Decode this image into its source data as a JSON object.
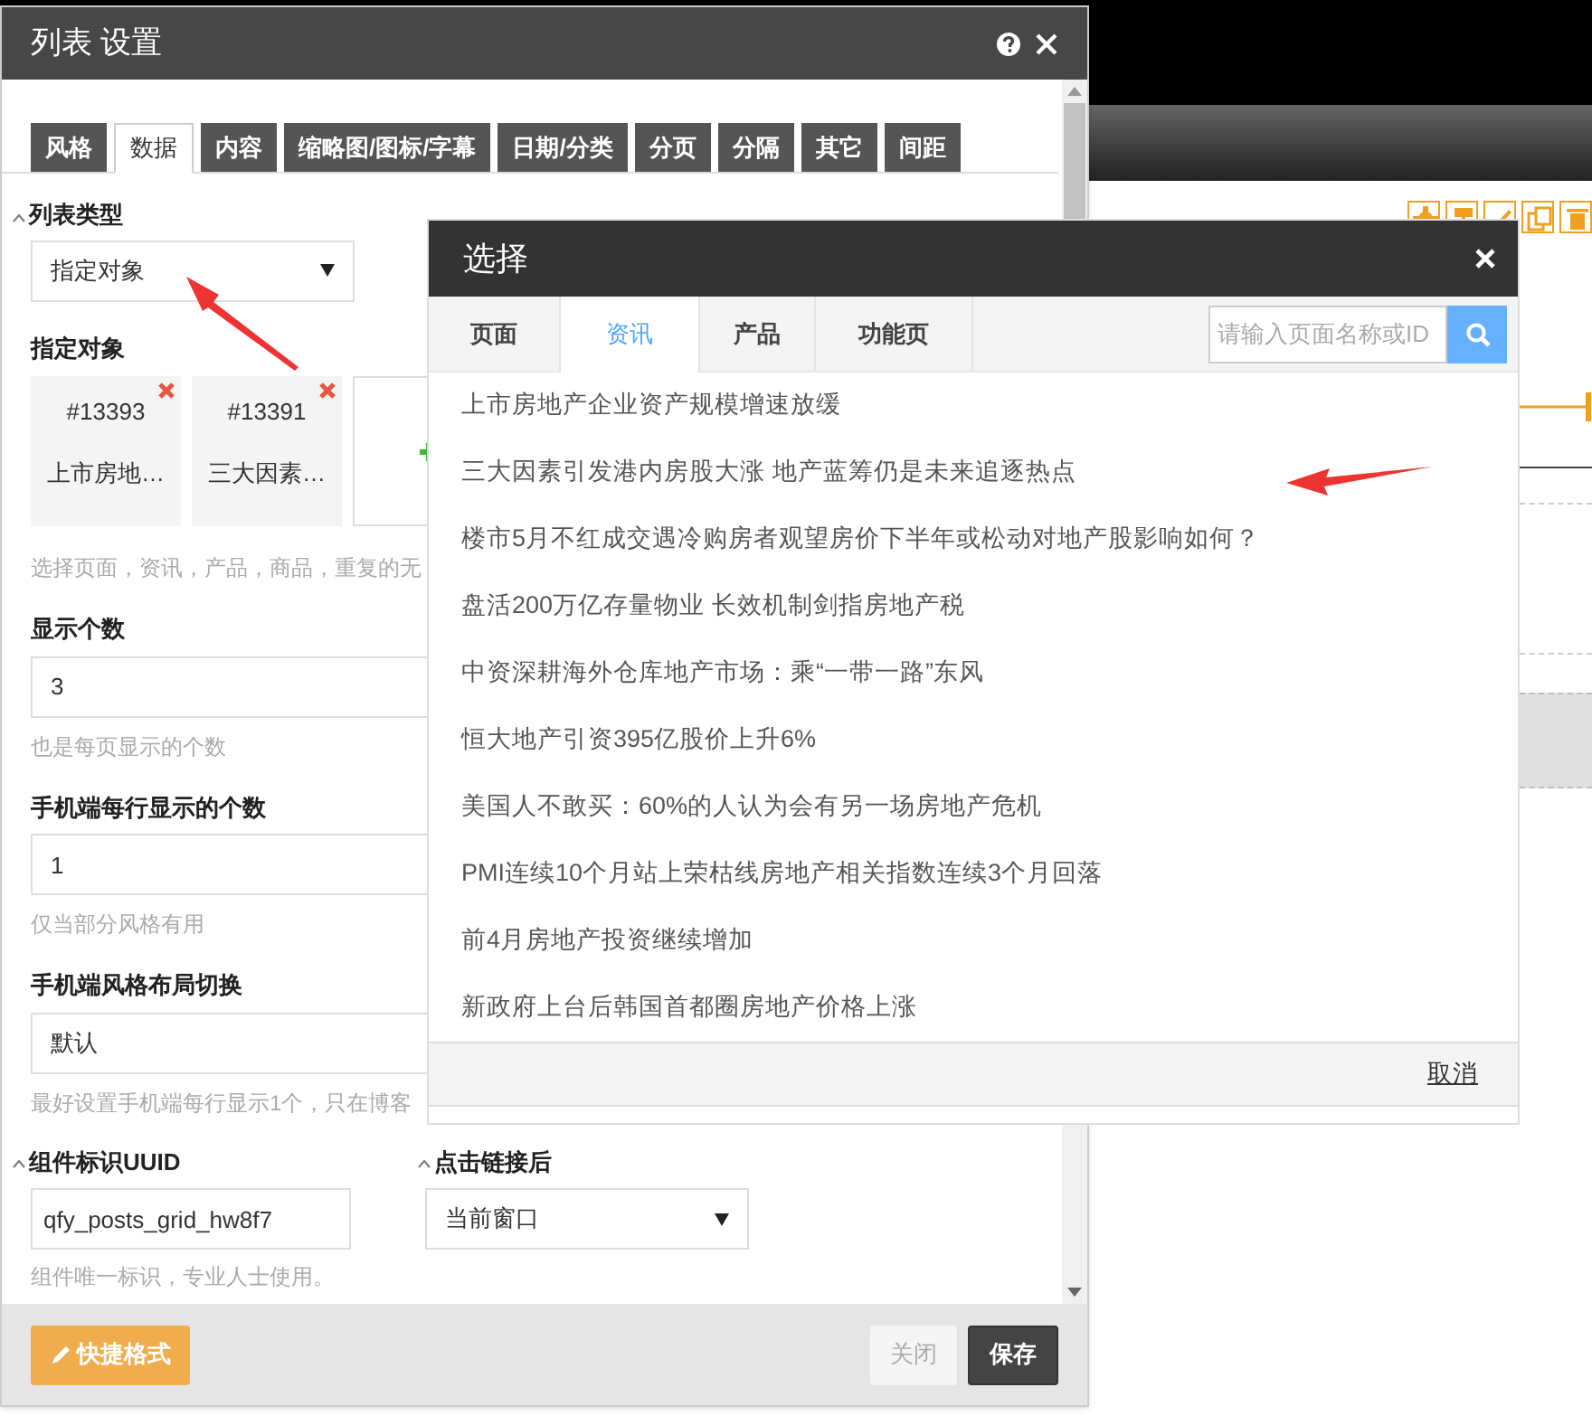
{
  "settings_dialog": {
    "title": "列表 设置",
    "tabs": [
      {
        "label": "风格",
        "selected": false
      },
      {
        "label": "数据",
        "selected": true
      },
      {
        "label": "内容",
        "selected": false
      },
      {
        "label": "缩略图/图标/字幕",
        "selected": false
      },
      {
        "label": "日期/分类",
        "selected": false
      },
      {
        "label": "分页",
        "selected": false
      },
      {
        "label": "分隔",
        "selected": false
      },
      {
        "label": "其它",
        "selected": false
      },
      {
        "label": "间距",
        "selected": false
      }
    ],
    "list_type": {
      "label": "列表类型",
      "value": "指定对象"
    },
    "targets": {
      "label": "指定对象",
      "items": [
        {
          "id": "#13393",
          "title": "上市房地…"
        },
        {
          "id": "#13391",
          "title": "三大因素…"
        }
      ],
      "hint": "选择页面，资讯，产品，商品，重复的无"
    },
    "fields": [
      {
        "label": "显示个数",
        "value": "3",
        "hint": "也是每页显示的个数"
      },
      {
        "label": "手机端每行显示的个数",
        "value": "1",
        "hint": "仅当部分风格有用"
      },
      {
        "label": "手机端风格布局切换",
        "value": "默认",
        "hint": "最好设置手机端每行显示1个，只在博客"
      }
    ],
    "uuid": {
      "label": "组件标识UUID",
      "value": "qfy_posts_grid_hw8f7",
      "hint": "组件唯一标识，专业人士使用。"
    },
    "link_target": {
      "label": "点击链接后",
      "value": "当前窗口"
    },
    "buttons": [
      {
        "label": "快捷格式",
        "kind": "format"
      },
      {
        "label": "关闭",
        "kind": "close"
      },
      {
        "label": "保存",
        "kind": "save"
      }
    ]
  },
  "select_dialog": {
    "title": "选择",
    "tabs": [
      {
        "label": "页面",
        "selected": false
      },
      {
        "label": "资讯",
        "selected": true
      },
      {
        "label": "产品",
        "selected": false
      },
      {
        "label": "功能页",
        "selected": false
      }
    ],
    "search": {
      "placeholder": "请输入页面名称或ID"
    },
    "items": [
      "上市房地产企业资产规模增速放缓",
      "三大因素引发港内房股大涨 地产蓝筹仍是未来追逐热点",
      "楼市5月不红成交遇冷购房者观望房价下半年或松动对地产股影响如何？",
      "盘活200万亿存量物业 长效机制剑指房地产税",
      "中资深耕海外仓库地产市场：乘“一带一路”东风",
      "恒大地产引资395亿股价上升6%",
      "美国人不敢买：60%的人认为会有另一场房地产危机",
      "PMI连续10个月站上荣枯线房地产相关指数连续3个月回落",
      "前4月房地产投资继续增加",
      "新政府上台后韩国首都圈房地产价格上涨"
    ],
    "cancel": "取消"
  }
}
